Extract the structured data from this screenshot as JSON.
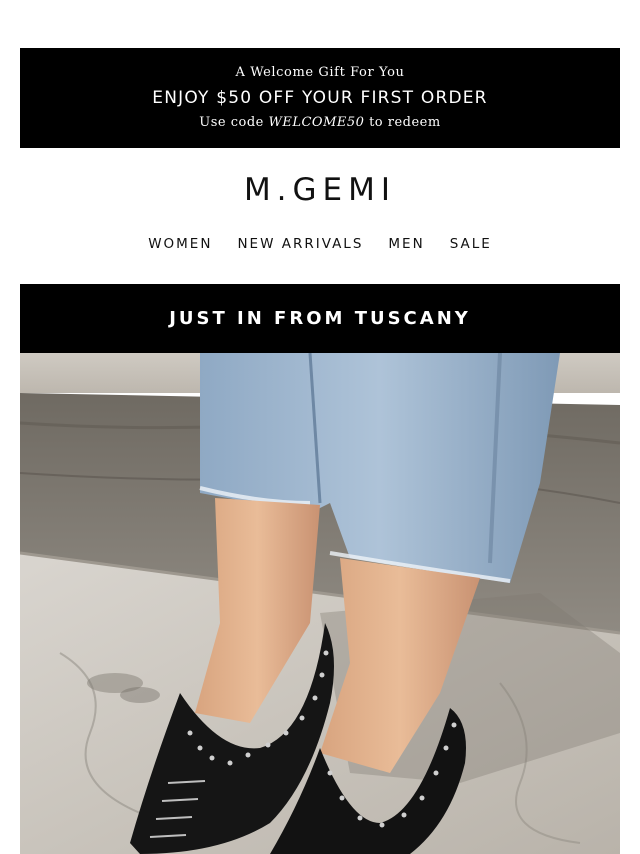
{
  "promo": {
    "kicker": "A Welcome Gift For You",
    "headline": "ENJOY $50 OFF YOUR FIRST ORDER",
    "code_prefix": "Use code",
    "code": "WELCOME50",
    "code_suffix": "to redeem"
  },
  "brand": {
    "logo_text": "M.GEMI"
  },
  "nav": {
    "items": [
      {
        "label": "WOMEN"
      },
      {
        "label": "NEW ARRIVALS"
      },
      {
        "label": "MEN"
      },
      {
        "label": "SALE"
      }
    ]
  },
  "banner": {
    "title": "JUST IN FROM TUSCANY"
  },
  "hero": {
    "image": "photo of feet wearing black suede studded flats and cropped light-wash jeans standing on marble steps"
  },
  "colors": {
    "banner_bg": "#000000",
    "banner_text": "#ffffff",
    "page_bg": "#ffffff",
    "text": "#111111"
  }
}
